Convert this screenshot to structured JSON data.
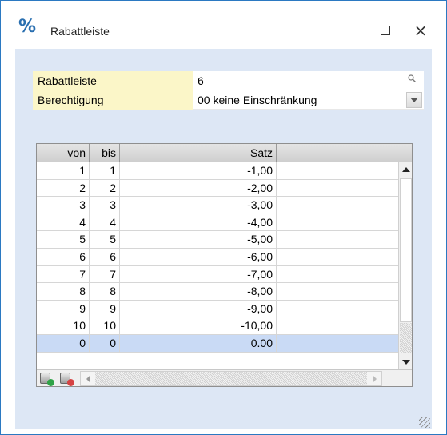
{
  "window": {
    "title": "Rabattleiste",
    "icon": "percent-icon",
    "icon_glyph": "%",
    "maximize_icon": "maximize-icon",
    "close_glyph": "×"
  },
  "form": {
    "rabattleiste_label": "Rabattleiste",
    "rabattleiste_value": "6",
    "berechtigung_label": "Berechtigung",
    "berechtigung_value": "00 keine Einschränkung"
  },
  "table": {
    "columns": [
      "von",
      "bis",
      "Satz",
      ""
    ],
    "rows": [
      {
        "von": "1",
        "bis": "1",
        "satz": "-1,00"
      },
      {
        "von": "2",
        "bis": "2",
        "satz": "-2,00"
      },
      {
        "von": "3",
        "bis": "3",
        "satz": "-3,00"
      },
      {
        "von": "4",
        "bis": "4",
        "satz": "-4,00"
      },
      {
        "von": "5",
        "bis": "5",
        "satz": "-5,00"
      },
      {
        "von": "6",
        "bis": "6",
        "satz": "-6,00"
      },
      {
        "von": "7",
        "bis": "7",
        "satz": "-7,00"
      },
      {
        "von": "8",
        "bis": "8",
        "satz": "-8,00"
      },
      {
        "von": "9",
        "bis": "9",
        "satz": "-9,00"
      },
      {
        "von": "10",
        "bis": "10",
        "satz": "-10,00"
      },
      {
        "von": "0",
        "bis": "0",
        "satz": "0.00"
      }
    ]
  },
  "colors": {
    "client_bg": "#dde7f5",
    "label_bg": "#fbf6c8",
    "new_row_bg": "#c9daf5",
    "window_border": "#2b79c2"
  }
}
